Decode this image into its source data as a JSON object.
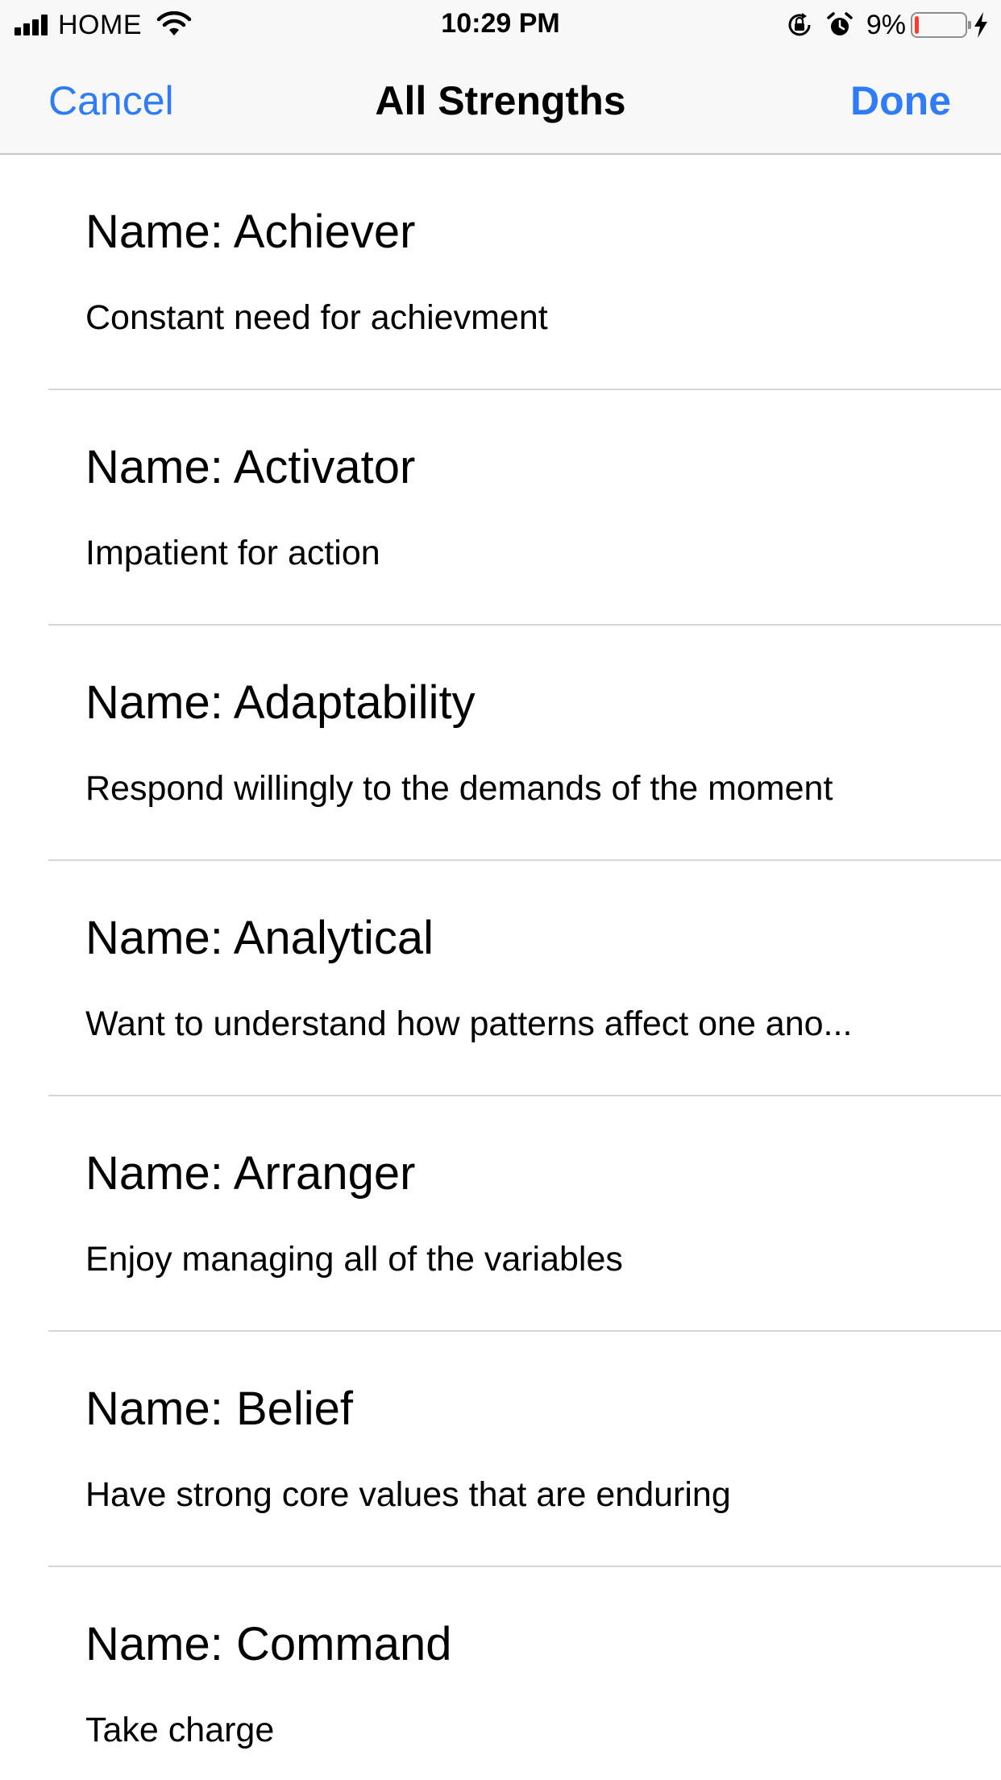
{
  "status_bar": {
    "carrier": "HOME",
    "time": "10:29 PM",
    "battery_percent": "9%",
    "battery_level": 0.09,
    "icons": [
      "signal-icon",
      "wifi-icon",
      "rotation-lock-icon",
      "alarm-icon",
      "battery-icon",
      "charging-bolt-icon"
    ]
  },
  "nav": {
    "cancel_label": "Cancel",
    "title": "All Strengths",
    "done_label": "Done"
  },
  "colors": {
    "accent": "#2f7cf6",
    "battery_low": "#ff3b30"
  },
  "strengths": [
    {
      "name": "Name: Achiever",
      "description": "Constant need for achievment"
    },
    {
      "name": "Name: Activator",
      "description": "Impatient for action"
    },
    {
      "name": "Name: Adaptability",
      "description": "Respond willingly to the demands of the moment"
    },
    {
      "name": "Name: Analytical",
      "description": "Want to understand how patterns affect one ano..."
    },
    {
      "name": "Name: Arranger",
      "description": "Enjoy managing all of the variables"
    },
    {
      "name": "Name: Belief",
      "description": "Have strong core values that are enduring"
    },
    {
      "name": "Name: Command",
      "description": "Take charge"
    }
  ]
}
